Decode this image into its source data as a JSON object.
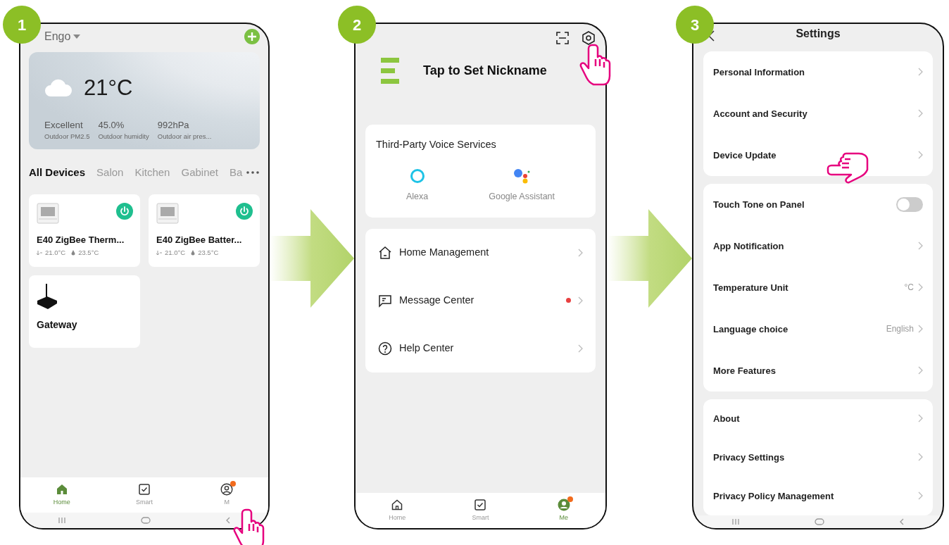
{
  "screens": [
    {
      "kind": "home",
      "step": "1",
      "home_name": "Engo",
      "weather": {
        "temperature": "21°C",
        "stats": [
          {
            "value": "Excellent",
            "label": "Outdoor PM2.5"
          },
          {
            "value": "45.0%",
            "label": "Outdoor humidity"
          },
          {
            "value": "992hPa",
            "label": "Outdoor air pres..."
          }
        ]
      },
      "rooms": [
        {
          "label": "All Devices",
          "selected": true
        },
        {
          "label": "Salon",
          "selected": false
        },
        {
          "label": "Kitchen",
          "selected": false
        },
        {
          "label": "Gabinet",
          "selected": false
        },
        {
          "label": "Ba",
          "selected": false
        }
      ],
      "devices": [
        {
          "kind": "thermostat",
          "name": "E40 ZigBee Therm...",
          "set_temp": "21.0°C",
          "room_temp": "23.5°C",
          "on": true
        },
        {
          "kind": "thermostat",
          "name": "E40 ZigBee Batter...",
          "set_temp": "21.0°C",
          "room_temp": "23.5°C",
          "on": true
        },
        {
          "kind": "gateway",
          "name": "Gateway"
        }
      ],
      "nav": [
        {
          "kind": "home",
          "label": "Home",
          "selected": true,
          "badge": false
        },
        {
          "kind": "smart",
          "label": "Smart",
          "selected": false,
          "badge": false
        },
        {
          "kind": "me",
          "label": "M",
          "selected": false,
          "badge": true
        }
      ]
    },
    {
      "kind": "profile",
      "step": "2",
      "nickname": "Tap to Set Nickname",
      "voice": {
        "title": "Third-Party Voice Services",
        "services": [
          {
            "kind": "alexa",
            "label": "Alexa"
          },
          {
            "kind": "google",
            "label": "Google Assistant"
          }
        ]
      },
      "menu": [
        {
          "kind": "home",
          "label": "Home Management",
          "unread": false
        },
        {
          "kind": "message",
          "label": "Message Center",
          "unread": true
        },
        {
          "kind": "help",
          "label": "Help Center",
          "unread": false
        }
      ],
      "nav": [
        {
          "kind": "home",
          "label": "Home",
          "selected": false,
          "badge": false
        },
        {
          "kind": "smart",
          "label": "Smart",
          "selected": false,
          "badge": false
        },
        {
          "kind": "me",
          "label": "Me",
          "selected": true,
          "badge": true
        }
      ]
    },
    {
      "kind": "settings",
      "step": "3",
      "title": "Settings",
      "groups": [
        [
          {
            "kind": "link",
            "label": "Personal Information"
          },
          {
            "kind": "link",
            "label": "Account and Security"
          },
          {
            "kind": "link",
            "label": "Device Update"
          }
        ],
        [
          {
            "kind": "toggle",
            "label": "Touch Tone on Panel",
            "on": false
          },
          {
            "kind": "link",
            "label": "App Notification"
          },
          {
            "kind": "link",
            "label": "Temperature Unit",
            "value": "°C"
          },
          {
            "kind": "link",
            "label": "Language choice",
            "value": "English"
          },
          {
            "kind": "link",
            "label": "More Features"
          }
        ],
        [
          {
            "kind": "link",
            "label": "About"
          },
          {
            "kind": "link",
            "label": "Privacy Settings"
          },
          {
            "kind": "link",
            "label": "Privacy Policy Management"
          }
        ]
      ]
    }
  ]
}
